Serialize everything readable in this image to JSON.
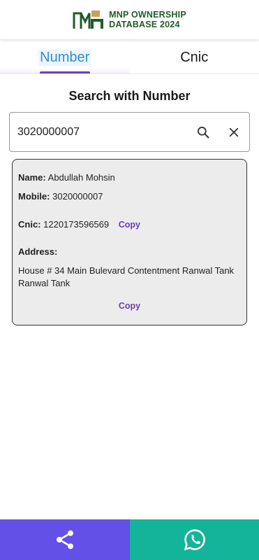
{
  "header": {
    "logo_icon": "mnp-logo-icon",
    "title_line1": "MNP OWNERSHIP",
    "title_line2": "DATABASE 2024",
    "brand_color": "#1f5b2a"
  },
  "tabs": [
    {
      "label": "Number",
      "active": true
    },
    {
      "label": "Cnic",
      "active": false
    }
  ],
  "colors": {
    "active_tab_text": "#2e8fd6",
    "tab_indicator": "#6b3fc4",
    "copy_link": "#6a3fb0",
    "share_bar": "#6350e6",
    "whatsapp_bar": "#14b49a"
  },
  "search": {
    "title": "Search with Number",
    "value": "3020000007",
    "search_icon": "search-icon",
    "clear_icon": "close-icon"
  },
  "result": {
    "name_label": "Name:",
    "name_value": "Abdullah Mohsin",
    "mobile_label": "Mobile:",
    "mobile_value": "3020000007",
    "cnic_label": "Cnic:",
    "cnic_value": "1220173596569",
    "cnic_copy": "Copy",
    "address_label": "Address:",
    "address_value": "House # 34 Main Bulevard Contentment Ranwal Tank Ranwal Tank",
    "address_copy": "Copy"
  },
  "bottom_bar": {
    "share_icon": "share-icon",
    "whatsapp_icon": "whatsapp-icon"
  }
}
